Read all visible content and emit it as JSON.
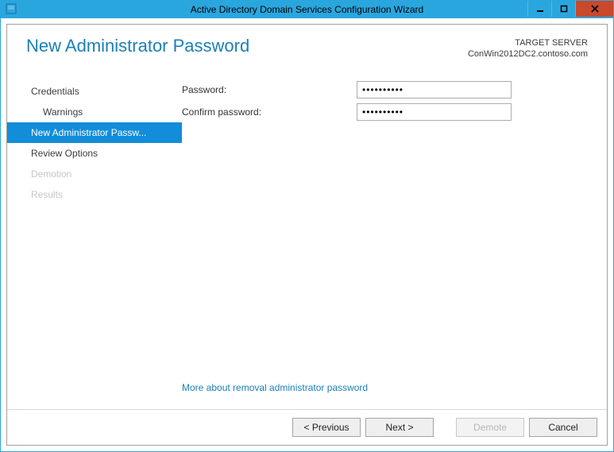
{
  "window_title": "Active Directory Domain Services Configuration Wizard",
  "header": {
    "page_title": "New Administrator Password",
    "target_label": "TARGET SERVER",
    "target_name": "ConWin2012DC2.contoso.com"
  },
  "sidebar": {
    "items": [
      {
        "label": "Credentials",
        "indented": false,
        "selected": false,
        "disabled": false
      },
      {
        "label": "Warnings",
        "indented": true,
        "selected": false,
        "disabled": false
      },
      {
        "label": "New Administrator Passw...",
        "indented": false,
        "selected": true,
        "disabled": false
      },
      {
        "label": "Review Options",
        "indented": false,
        "selected": false,
        "disabled": false
      },
      {
        "label": "Demotion",
        "indented": false,
        "selected": false,
        "disabled": true
      },
      {
        "label": "Results",
        "indented": false,
        "selected": false,
        "disabled": true
      }
    ]
  },
  "form": {
    "password_label": "Password:",
    "password_value": "••••••••••",
    "confirm_label": "Confirm password:",
    "confirm_value": "••••••••••"
  },
  "help_link": "More about removal administrator password",
  "buttons": {
    "previous": "< Previous",
    "next": "Next >",
    "demote": "Demote",
    "cancel": "Cancel"
  }
}
